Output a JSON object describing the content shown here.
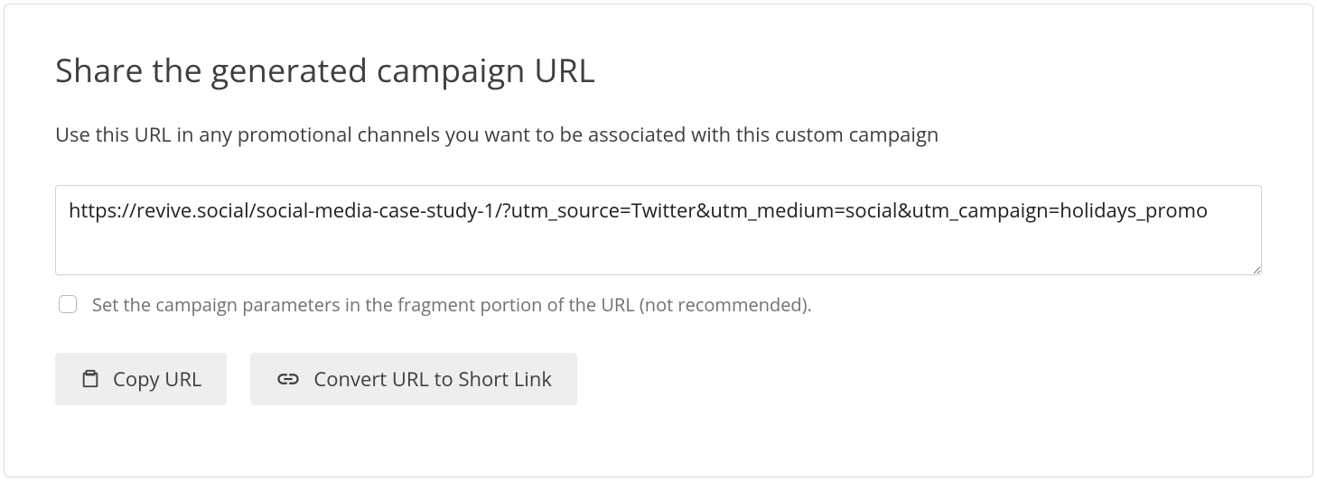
{
  "heading": "Share the generated campaign URL",
  "subheading": "Use this URL in any promotional channels you want to be associated with this custom campaign",
  "url_value": "https://revive.social/social-media-case-study-1/?utm_source=Twitter&utm_medium=social&utm_campaign=holidays_promo",
  "fragment_checkbox": {
    "checked": false,
    "label": "Set the campaign parameters in the fragment portion of the URL (not recommended)."
  },
  "buttons": {
    "copy": "Copy URL",
    "shorten": "Convert URL to Short Link"
  }
}
